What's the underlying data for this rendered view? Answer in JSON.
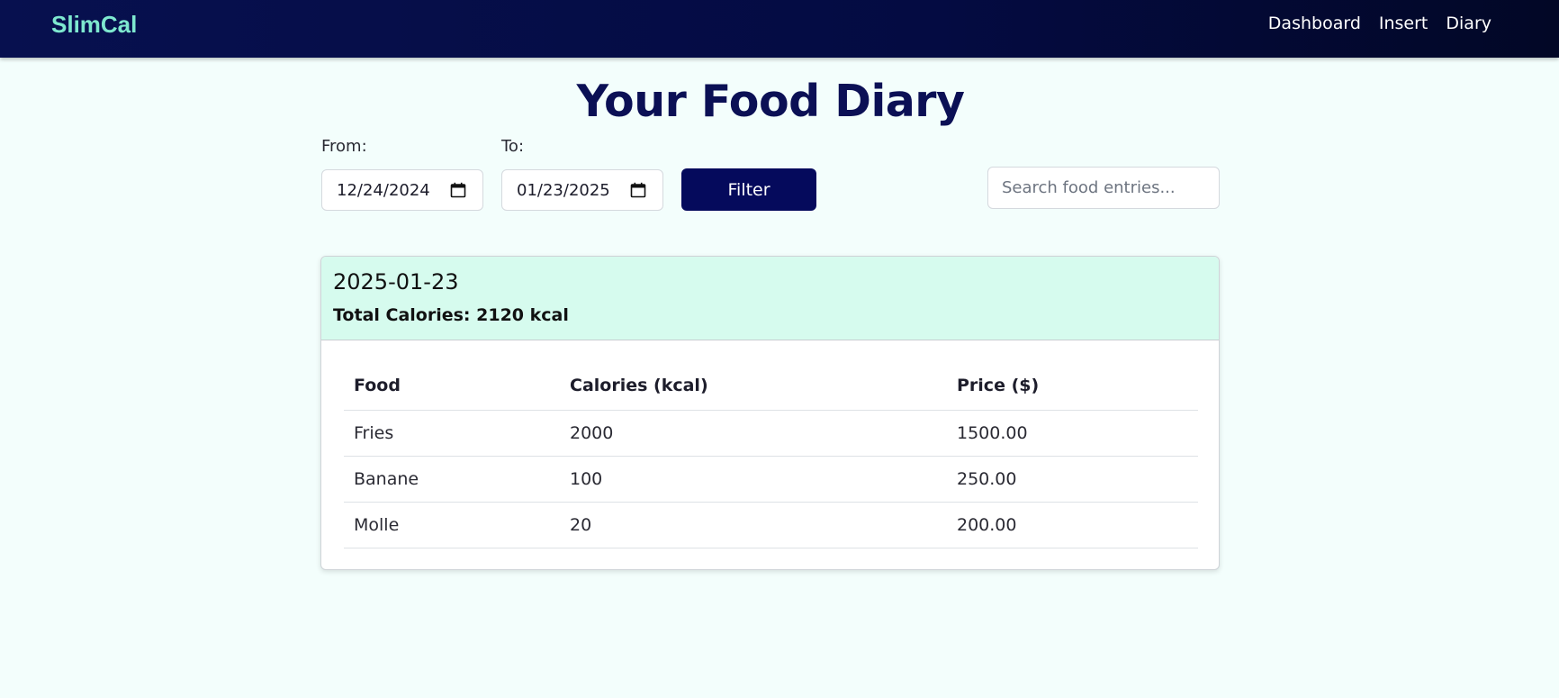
{
  "nav": {
    "brand": "SlimCal",
    "links": [
      "Dashboard",
      "Insert",
      "Diary"
    ]
  },
  "page": {
    "title": "Your Food Diary"
  },
  "filters": {
    "from_label": "From:",
    "from_value": "12/24/2024",
    "to_label": "To:",
    "to_value": "01/23/2025",
    "filter_button": "Filter",
    "search_placeholder": "Search food entries..."
  },
  "entry": {
    "date": "2025-01-23",
    "total": "Total Calories: 2120 kcal",
    "columns": [
      "Food",
      "Calories (kcal)",
      "Price ($)"
    ],
    "rows": [
      [
        "Fries",
        "2000",
        "1500.00"
      ],
      [
        "Banane",
        "100",
        "250.00"
      ],
      [
        "Molle",
        "20",
        "200.00"
      ]
    ]
  },
  "colors": {
    "navbar": "#07104f",
    "brand": "#7ee8cf",
    "primary": "#050a5c",
    "card_header": "#d6fbee",
    "page_bg": "#f3fefc"
  },
  "icons": {
    "date_picker": "calendar-icon"
  }
}
